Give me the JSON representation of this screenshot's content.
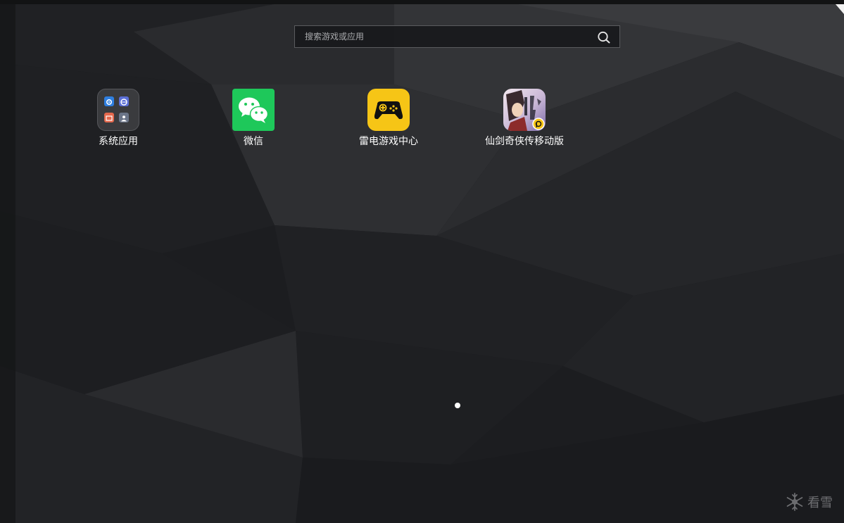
{
  "search": {
    "placeholder": "搜索游戏或应用",
    "value": ""
  },
  "apps": [
    {
      "label": "系统应用",
      "icon": "system-apps-folder-icon"
    },
    {
      "label": "微信",
      "icon": "wechat-icon"
    },
    {
      "label": "雷电游戏中心",
      "icon": "leidian-game-center-icon"
    },
    {
      "label": "仙剑奇侠传移动版",
      "icon": "xianjian-game-icon"
    }
  ],
  "pager": {
    "current_page": 1,
    "total_pages": 1
  },
  "watermark": {
    "text": "看雪",
    "icon": "snowflake-icon"
  },
  "colors": {
    "wechat_green": "#1ec85a",
    "game_center_yellow": "#f6c516",
    "page_dot": "#ffffff",
    "label_text": "#ffffff"
  }
}
